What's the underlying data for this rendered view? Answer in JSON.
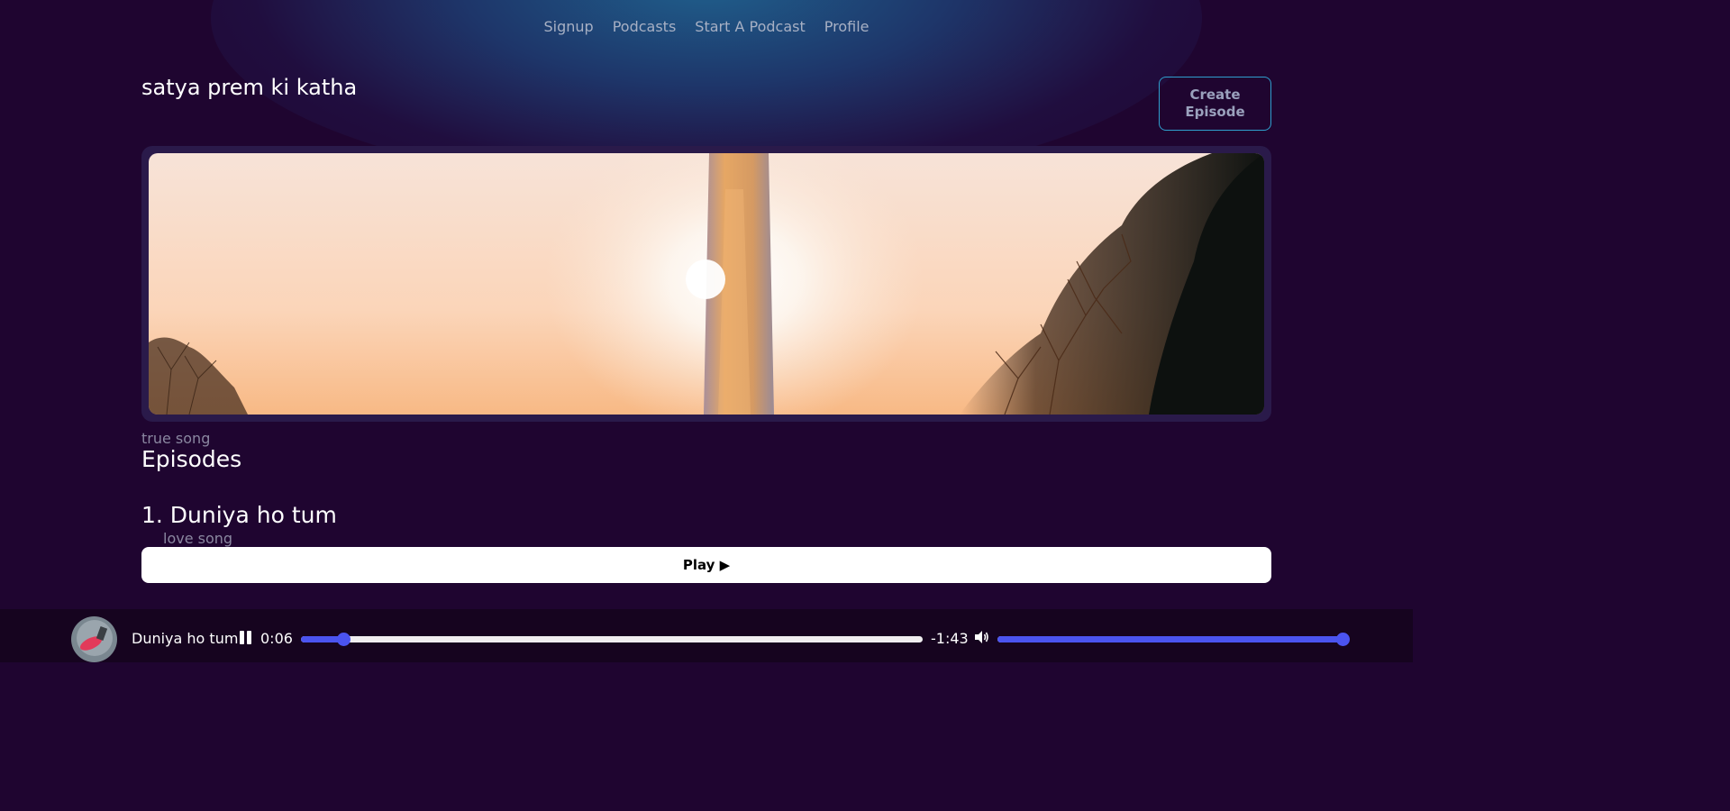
{
  "nav": {
    "items": [
      "Signup",
      "Podcasts",
      "Start A Podcast",
      "Profile"
    ]
  },
  "podcast": {
    "title": "satya prem ki katha",
    "description": "true song",
    "create_episode_label": "Create Episode",
    "banner_image": "sunset-monument-photo"
  },
  "episodes_section": {
    "heading": "Episodes",
    "items": [
      {
        "title": "1. Duniya ho tum",
        "description": "love song",
        "play_label": "Play ▶"
      }
    ]
  },
  "player": {
    "track_title": "Duniya ho tum",
    "current_time": "0:06",
    "remaining_time": "-1:43",
    "progress_fraction": 0.068,
    "volume_fraction": 1.0,
    "state_icon": "pause-icon",
    "volume_icon": "speaker-icon"
  },
  "colors": {
    "background": "#1f0530",
    "accent": "#4b54f0",
    "create_button_border": "#2f9fcd",
    "muted_text": "#8a87a0",
    "nav_text": "#a7b0c4"
  }
}
